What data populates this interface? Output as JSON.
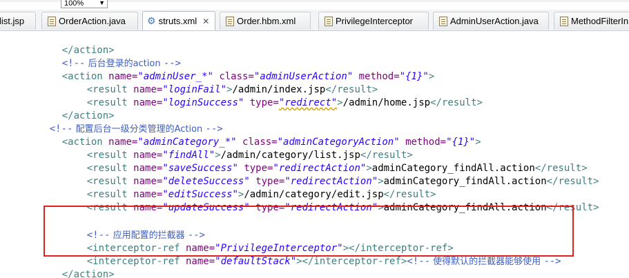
{
  "toolbar": {
    "zoom": "100%"
  },
  "tabs": [
    {
      "label": "list.jsp",
      "icon": "jsp-file-icon",
      "active": false
    },
    {
      "label": "OrderAction.java",
      "icon": "java-file-icon",
      "active": false
    },
    {
      "label": "struts.xml",
      "icon": "xml-gear-icon",
      "active": true,
      "close": "✕"
    },
    {
      "label": "Order.hbm.xml",
      "icon": "xml-file-icon",
      "active": false
    },
    {
      "label": "PrivilegeInterceptor",
      "icon": "java-file-icon",
      "active": false
    },
    {
      "label": "AdminUserAction.java",
      "icon": "java-file-icon",
      "active": false
    },
    {
      "label": "MethodFilterIn",
      "icon": "class-file-icon",
      "active": false
    }
  ],
  "code": {
    "l01": {
      "close": "</action>"
    },
    "l02": {
      "open": "<!--",
      "text": " 后台登录的action ",
      "close": "-->"
    },
    "l03": {
      "tag": "<action",
      "a1": " name=",
      "v1": "\"adminUser_*\"",
      "a2": " class=",
      "v2": "\"adminUserAction\"",
      "a3": " method=",
      "v3": "\"{1}\"",
      "end": ">"
    },
    "l04": {
      "tag": "<result",
      "a1": " name=",
      "v1": "\"loginFail\"",
      "end": ">",
      "text": "/admin/index.jsp",
      "close": "</result>"
    },
    "l05": {
      "tag": "<result",
      "a1": " name=",
      "v1": "\"loginSuccess\"",
      "a2": " type=",
      "v2": "\"redirect\"",
      "end": ">",
      "text": "/admin/home.jsp",
      "close": "</result>"
    },
    "l06": {
      "close": "</action>"
    },
    "l07": {
      "open": "<!--",
      "text": " 配置后台一级分类管理的Action ",
      "close": "-->"
    },
    "l08": {
      "tag": "<action",
      "a1": " name=",
      "v1": "\"adminCategory_*\"",
      "a2": " class=",
      "v2": "\"adminCategoryAction\"",
      "a3": " method=",
      "v3": "\"{1}\"",
      "end": ">"
    },
    "l09": {
      "tag": "<result",
      "a1": " name=",
      "v1": "\"findAll\"",
      "end": ">",
      "text": "/admin/category/list.jsp",
      "close": "</result>"
    },
    "l10": {
      "tag": "<result",
      "a1": " name=",
      "v1": "\"saveSuccess\"",
      "a2": " type=",
      "v2": "\"redirectAction\"",
      "end": ">",
      "text": "adminCategory_findAll.action",
      "close": "</result>"
    },
    "l11": {
      "tag": "<result",
      "a1": " name=",
      "v1": "\"deleteSuccess\"",
      "a2": " type=",
      "v2": "\"redirectAction\"",
      "end": ">",
      "text": "adminCategory_findAll.action",
      "close": "</result>"
    },
    "l12": {
      "tag": "<result",
      "a1": " name=",
      "v1": "\"editSuccess\"",
      "end": ">",
      "text": "/admin/category/edit.jsp",
      "close": "</result>"
    },
    "l13": {
      "tag": "<result",
      "a1": " name=",
      "v1": "\"updateSuccess\"",
      "a2": " type=",
      "v2": "\"redirectAction\"",
      "end": ">",
      "text": "adminCategory_findAll.action",
      "close": "</result>"
    },
    "l14": {
      "open": "<!--",
      "text": " 应用配置的拦截器 ",
      "close": "-->"
    },
    "l15": {
      "tag": "<interceptor-ref",
      "a1": " name=",
      "v1": "\"PrivilegeInterceptor\"",
      "end": ">",
      "close": "</interceptor-ref>"
    },
    "l16": {
      "tag": "<interceptor-ref",
      "a1": " name=",
      "v1": "\"defaultStack\"",
      "end": ">",
      "close": "</interceptor-ref>",
      "copen": "<!--",
      "ctext": " 使得默认的拦截器能够使用 ",
      "cclose": "-->"
    },
    "l17": {
      "close": "</action>"
    }
  },
  "colors": {
    "tag": "#3f7f7f",
    "attribute": "#7f007f",
    "value": "#2a00ff",
    "comment": "#3f5fbf",
    "highlight": "#e02020"
  }
}
